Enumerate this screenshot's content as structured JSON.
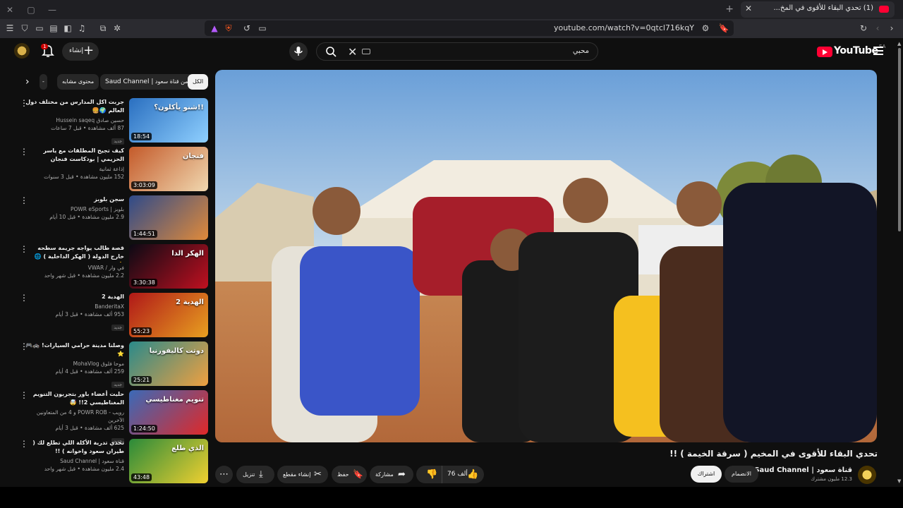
{
  "browser": {
    "tab_title": "(1) تحدي البقاء للأقوى في المخ...",
    "url": "youtube.com/watch?v=0qtcl716kqY"
  },
  "youtube": {
    "logo_text": "YouTube",
    "region": "SA",
    "search_query": "محبي",
    "create_label": "إنشاء",
    "notification_count": "1"
  },
  "chips": {
    "all": "الكل",
    "from_channel": "من قناة سعود",
    "channel_name": "Saud Channel |",
    "related": "محتوى مشابه"
  },
  "videos": [
    {
      "title": "جربت اكل المدارس من مختلف دول العالم 🌍🍔",
      "channel": "حسين صادق Hussein saqeq",
      "stats": "87 ألف مشاهدة • قبل 7 ساعات",
      "badge": "جديد",
      "duration": "18:54",
      "thumb_text": "شنو يأكلون؟!!"
    },
    {
      "title": "كيف تجيح المطلقات مع ياسر الحزيمي | بودكاست فنجان",
      "channel": "إذاعة ثمانية",
      "stats": "152 مليون مشاهدة • قبل 3 سنوات",
      "badge": "",
      "duration": "3:03:09",
      "thumb_text": "فنجان"
    },
    {
      "title": "سجن بلوبز",
      "channel": "بلوبز | POWR eSports",
      "stats": "2.9 مليون مشاهدة • قبل 10 أيام",
      "badge": "",
      "duration": "1:44:51",
      "thumb_text": ""
    },
    {
      "title": "قصة طالب يواجه جريمة سطحه خارج الدولة ( الهكر الداخلية ) 🌐⚠️!",
      "channel": "في وار / VWAR",
      "stats": "2.2 مليون مشاهدة • قبل شهر واحد",
      "badge": "",
      "duration": "3:30:38",
      "thumb_text": "الهكر الدا"
    },
    {
      "title": "الهدية 2",
      "channel": "BanderitaX",
      "stats": "953 ألف مشاهدة • قبل 3 أيام",
      "badge": "جديد",
      "duration": "55:23",
      "thumb_text": "الهدية 2"
    },
    {
      "title": "وصلنا مدينة حرامي السيارات! 🚓🎮⭐",
      "channel": "موحا فلوق MohaVlog",
      "stats": "259 ألف مشاهدة • قبل 4 أيام",
      "badge": "جديد",
      "duration": "25:21",
      "thumb_text": "دوتت كاليفورنيا"
    },
    {
      "title": "حليت أعضاء باور بتجربون التنويم المغناطيسي 2!! 🤯",
      "channel": "رويب - POWR ROB و 4 من المتعاونين الآخرين",
      "stats": "625 ألف مشاهدة • قبل 3 أيام",
      "badge": "جديد",
      "duration": "1:24:50",
      "thumb_text": "تنويم مغناطيسي"
    },
    {
      "title": "تحدي تدرية الأكلة اللي تطلع لك ( طيران سعود واخوانه ) !!",
      "channel": "قناة سعود | Saud Channel",
      "stats": "2.4 مليون مشاهدة • قبل شهر واحد",
      "badge": "",
      "duration": "43:48",
      "thumb_text": "الذي طلع"
    }
  ],
  "main_video": {
    "title": "تحدي البقاء للأقوى في المخيم ( سرقة الخيمة ) !!",
    "channel": "قناة سعود | Saud Channel",
    "subscribers": "12.3 مليون مشترك",
    "join_label": "الانضمام",
    "subscribe_label": "اشتراك",
    "likes": "76 ألف",
    "share_label": "مشاركة",
    "save_label": "حفظ",
    "clip_label": "إنشاء مقطع",
    "download_label": "تنزيل"
  }
}
